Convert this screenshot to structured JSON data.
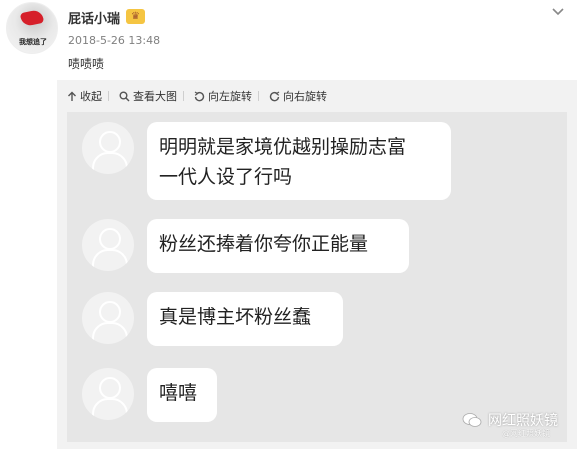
{
  "user": {
    "name": "屁话小瑞",
    "avatar_text": "我想追了",
    "badge_icon": "vip-crown-icon",
    "timestamp": "2018-5-26 13:48"
  },
  "post": {
    "text": "啧啧啧"
  },
  "toolbar": {
    "collapse_label": "收起",
    "view_large_label": "查看大图",
    "rotate_left_label": "向左旋转",
    "rotate_right_label": "向右旋转"
  },
  "chat": {
    "messages": [
      {
        "line1": "明明就是家境优越别操励志富",
        "line2": "一代人设了行吗"
      },
      {
        "line1": "粉丝还捧着你夸你正能量"
      },
      {
        "line1": "真是博主坏粉丝蠢"
      },
      {
        "line1": "嘻嘻"
      }
    ]
  },
  "watermark": {
    "text": "网红照妖镜",
    "subtext": "@网红照妖镜"
  },
  "colors": {
    "viewer_bg": "#f2f2f2",
    "photo_bg": "#e6e6e6",
    "badge": "#f5c542"
  }
}
